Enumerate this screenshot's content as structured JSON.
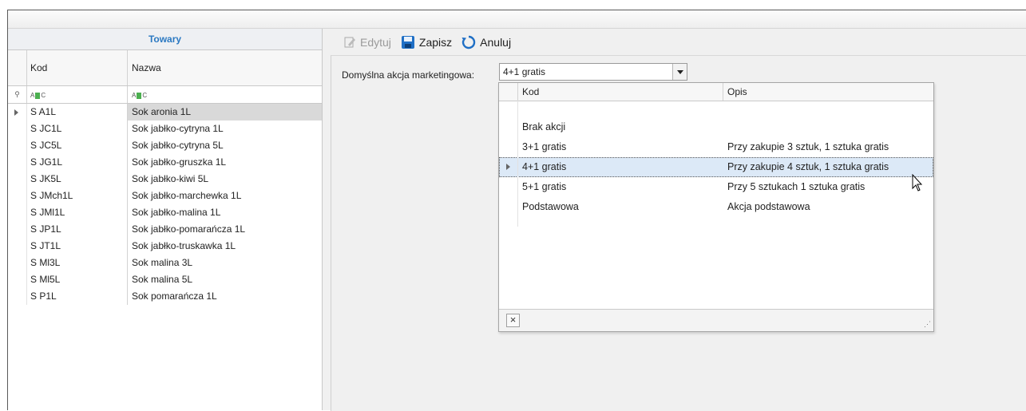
{
  "left_grid": {
    "title": "Towary",
    "columns": {
      "kod": "Kod",
      "nazwa": "Nazwa"
    },
    "filter_label": "ABC",
    "rows": [
      {
        "kod": "S A1L",
        "nazwa": "Sok aronia 1L"
      },
      {
        "kod": "S JC1L",
        "nazwa": "Sok jabłko-cytryna 1L"
      },
      {
        "kod": "S JC5L",
        "nazwa": "Sok jabłko-cytryna 5L"
      },
      {
        "kod": "S JG1L",
        "nazwa": "Sok jabłko-gruszka 1L"
      },
      {
        "kod": "S JK5L",
        "nazwa": "Sok jabłko-kiwi 5L"
      },
      {
        "kod": "S JMch1L",
        "nazwa": "Sok jabłko-marchewka 1L"
      },
      {
        "kod": "S JMl1L",
        "nazwa": "Sok jabłko-malina 1L"
      },
      {
        "kod": "S JP1L",
        "nazwa": "Sok jabłko-pomarańcza 1L"
      },
      {
        "kod": "S JT1L",
        "nazwa": "Sok jabłko-truskawka 1L"
      },
      {
        "kod": "S Ml3L",
        "nazwa": "Sok malina 3L"
      },
      {
        "kod": "S Ml5L",
        "nazwa": "Sok malina 5L"
      },
      {
        "kod": "S P1L",
        "nazwa": "Sok pomarańcza 1L"
      }
    ]
  },
  "toolbar": {
    "edit": "Edytuj",
    "save": "Zapisz",
    "cancel": "Anuluj"
  },
  "form": {
    "label": "Domyślna akcja marketingowa:",
    "value": "4+1 gratis"
  },
  "dropdown": {
    "columns": {
      "kod": "Kod",
      "opis": "Opis"
    },
    "rows": [
      {
        "kod": "",
        "opis": ""
      },
      {
        "kod": "Brak akcji",
        "opis": ""
      },
      {
        "kod": "3+1 gratis",
        "opis": "Przy zakupie 3 sztuk, 1 sztuka gratis"
      },
      {
        "kod": "4+1 gratis",
        "opis": "Przy zakupie 4 sztuk, 1 sztuka gratis"
      },
      {
        "kod": "5+1 gratis",
        "opis": "Przy 5 sztukach 1 sztuka gratis"
      },
      {
        "kod": "Podstawowa",
        "opis": "Akcja podstawowa"
      }
    ],
    "clear_label": "×"
  },
  "colors": {
    "accent": "#2b79c2",
    "save_icon": "#1f6fc5",
    "selection": "#dce9f7"
  }
}
